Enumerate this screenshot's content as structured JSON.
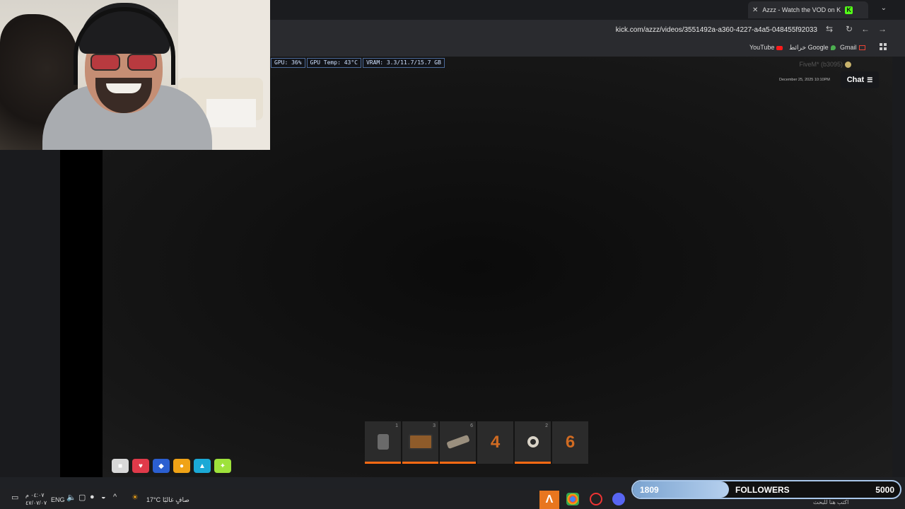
{
  "browser": {
    "tab_title": "Azzz - Watch the VOD on K",
    "url": "kick.com/azzz/videos/3551492a-a360-4227-a4a5-048455f92033",
    "new_tab": "+",
    "tab_close": "✕",
    "tab_search": "⌄",
    "reload": "↻",
    "back": "←",
    "forward": "→",
    "bookmarks": [
      {
        "label": "YouTube"
      },
      {
        "label": "خرائط Google"
      },
      {
        "label": "Gmail"
      }
    ]
  },
  "overlay": {
    "perf": [
      "GPU: 36%",
      "GPU Temp: 43°C",
      "VRAM: 3.3/11.7/15.7 GB"
    ],
    "fivem": "FiveM* (b3095)",
    "date": "December 25, 2025 10:10PM"
  },
  "chat": {
    "label": "Chat"
  },
  "hotbar": {
    "slots": [
      {
        "num": "1",
        "active": true,
        "item": "gun"
      },
      {
        "num": "3",
        "active": true,
        "item": "box"
      },
      {
        "num": "6",
        "active": true,
        "item": "knife"
      },
      {
        "num": "",
        "active": false,
        "big": "4"
      },
      {
        "num": "2",
        "active": true,
        "item": "ring"
      },
      {
        "num": "",
        "active": false,
        "big": "6"
      }
    ]
  },
  "status_icons": [
    {
      "name": "armor-icon",
      "color": "#d8d8d8"
    },
    {
      "name": "health-icon",
      "color": "#e03a4a"
    },
    {
      "name": "shield-icon",
      "color": "#2b5fd1"
    },
    {
      "name": "food-icon",
      "color": "#f0a316"
    },
    {
      "name": "water-icon",
      "color": "#1ba9d6"
    },
    {
      "name": "stamina-icon",
      "color": "#9ee23b"
    }
  ],
  "taskbar": {
    "time": "٠٤:٠٧ م",
    "date": "٤٧/٠٧/٠٧",
    "lang": "ENG",
    "weather_temp": "17°C",
    "weather_desc": "صافٍ غالبًا",
    "search_placeholder": "اكتب هنا للبحث"
  },
  "followers": {
    "current": "1809",
    "label": "FOLLOWERS",
    "goal": "5000",
    "progress": 0.36
  }
}
